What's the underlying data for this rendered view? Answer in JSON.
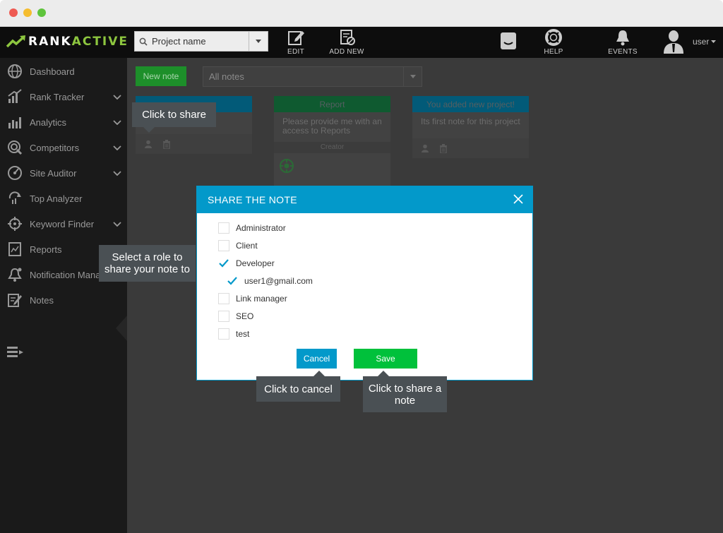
{
  "app": {
    "logo_left": "RANK",
    "logo_right": "ACTIVE",
    "colors": {
      "accent_blue": "#0399ca",
      "save_green": "#00c13b",
      "new_note_green": "#1d8f2a",
      "logo_green": "#8dc63f"
    }
  },
  "topbar": {
    "project_placeholder": "Project name",
    "edit_label": "EDIT",
    "add_new_label": "ADD NEW",
    "help_label": "HELP",
    "events_label": "EVENTS",
    "user_label": "user"
  },
  "sidebar": {
    "items": [
      {
        "label": "Dashboard",
        "icon": "globe-icon",
        "has_chevron": false
      },
      {
        "label": "Rank Tracker",
        "icon": "bar-chart-icon",
        "has_chevron": true
      },
      {
        "label": "Analytics",
        "icon": "analytics-icon",
        "has_chevron": true
      },
      {
        "label": "Competitors",
        "icon": "target-icon",
        "has_chevron": true
      },
      {
        "label": "Site Auditor",
        "icon": "gauge-icon",
        "has_chevron": true
      },
      {
        "label": "Top Analyzer",
        "icon": "refresh-icon",
        "has_chevron": false
      },
      {
        "label": "Keyword Finder",
        "icon": "crosshair-icon",
        "has_chevron": true
      },
      {
        "label": "Reports",
        "icon": "report-icon",
        "has_chevron": false
      },
      {
        "label": "Notification Mana",
        "icon": "bell-icon",
        "has_chevron": false
      },
      {
        "label": "Notes",
        "icon": "notes-icon",
        "has_chevron": false
      }
    ]
  },
  "toolbar": {
    "new_note_label": "New note",
    "filter_value": "All notes"
  },
  "notes": [
    {
      "title": "",
      "text": ""
    },
    {
      "title": "Report",
      "text": "Please provide me with an access to Reports",
      "creator_label": "Creator"
    },
    {
      "title": "You added new project!",
      "text": "Its first note for this project"
    }
  ],
  "tooltips": {
    "share": "Click to share",
    "role": "Select a role to share your note to",
    "cancel": "Click to cancel",
    "save": "Click to share a note"
  },
  "dialog": {
    "title": "SHARE THE NOTE",
    "roles": [
      {
        "label": "Administrator",
        "checked": false
      },
      {
        "label": "Client",
        "checked": false
      },
      {
        "label": "Developer",
        "checked": true
      },
      {
        "label": "user1@gmail.com",
        "checked": true
      },
      {
        "label": "Link manager",
        "checked": false
      },
      {
        "label": "SEO",
        "checked": false
      },
      {
        "label": "test",
        "checked": false
      }
    ],
    "cancel_label": "Cancel",
    "save_label": "Save"
  }
}
